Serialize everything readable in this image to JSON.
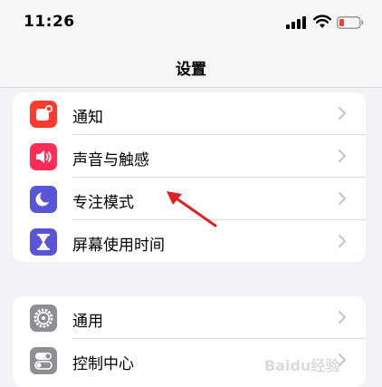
{
  "status_bar": {
    "time": "11:26"
  },
  "nav": {
    "title": "设置"
  },
  "groups": [
    {
      "items": [
        {
          "label": "通知",
          "icon": "bell-icon",
          "color": "#ff3b30"
        },
        {
          "label": "声音与触感",
          "icon": "speaker-icon",
          "color": "#ff2d55"
        },
        {
          "label": "专注模式",
          "icon": "moon-icon",
          "color": "#5856d6"
        },
        {
          "label": "屏幕使用时间",
          "icon": "hourglass-icon",
          "color": "#5856d6"
        }
      ]
    },
    {
      "items": [
        {
          "label": "通用",
          "icon": "gear-icon",
          "color": "#8e8e93"
        },
        {
          "label": "控制中心",
          "icon": "toggles-icon",
          "color": "#8e8e93"
        }
      ]
    }
  ],
  "annotation": {
    "arrow_color": "#e02020"
  },
  "watermark": {
    "text": "Baidu经验"
  }
}
